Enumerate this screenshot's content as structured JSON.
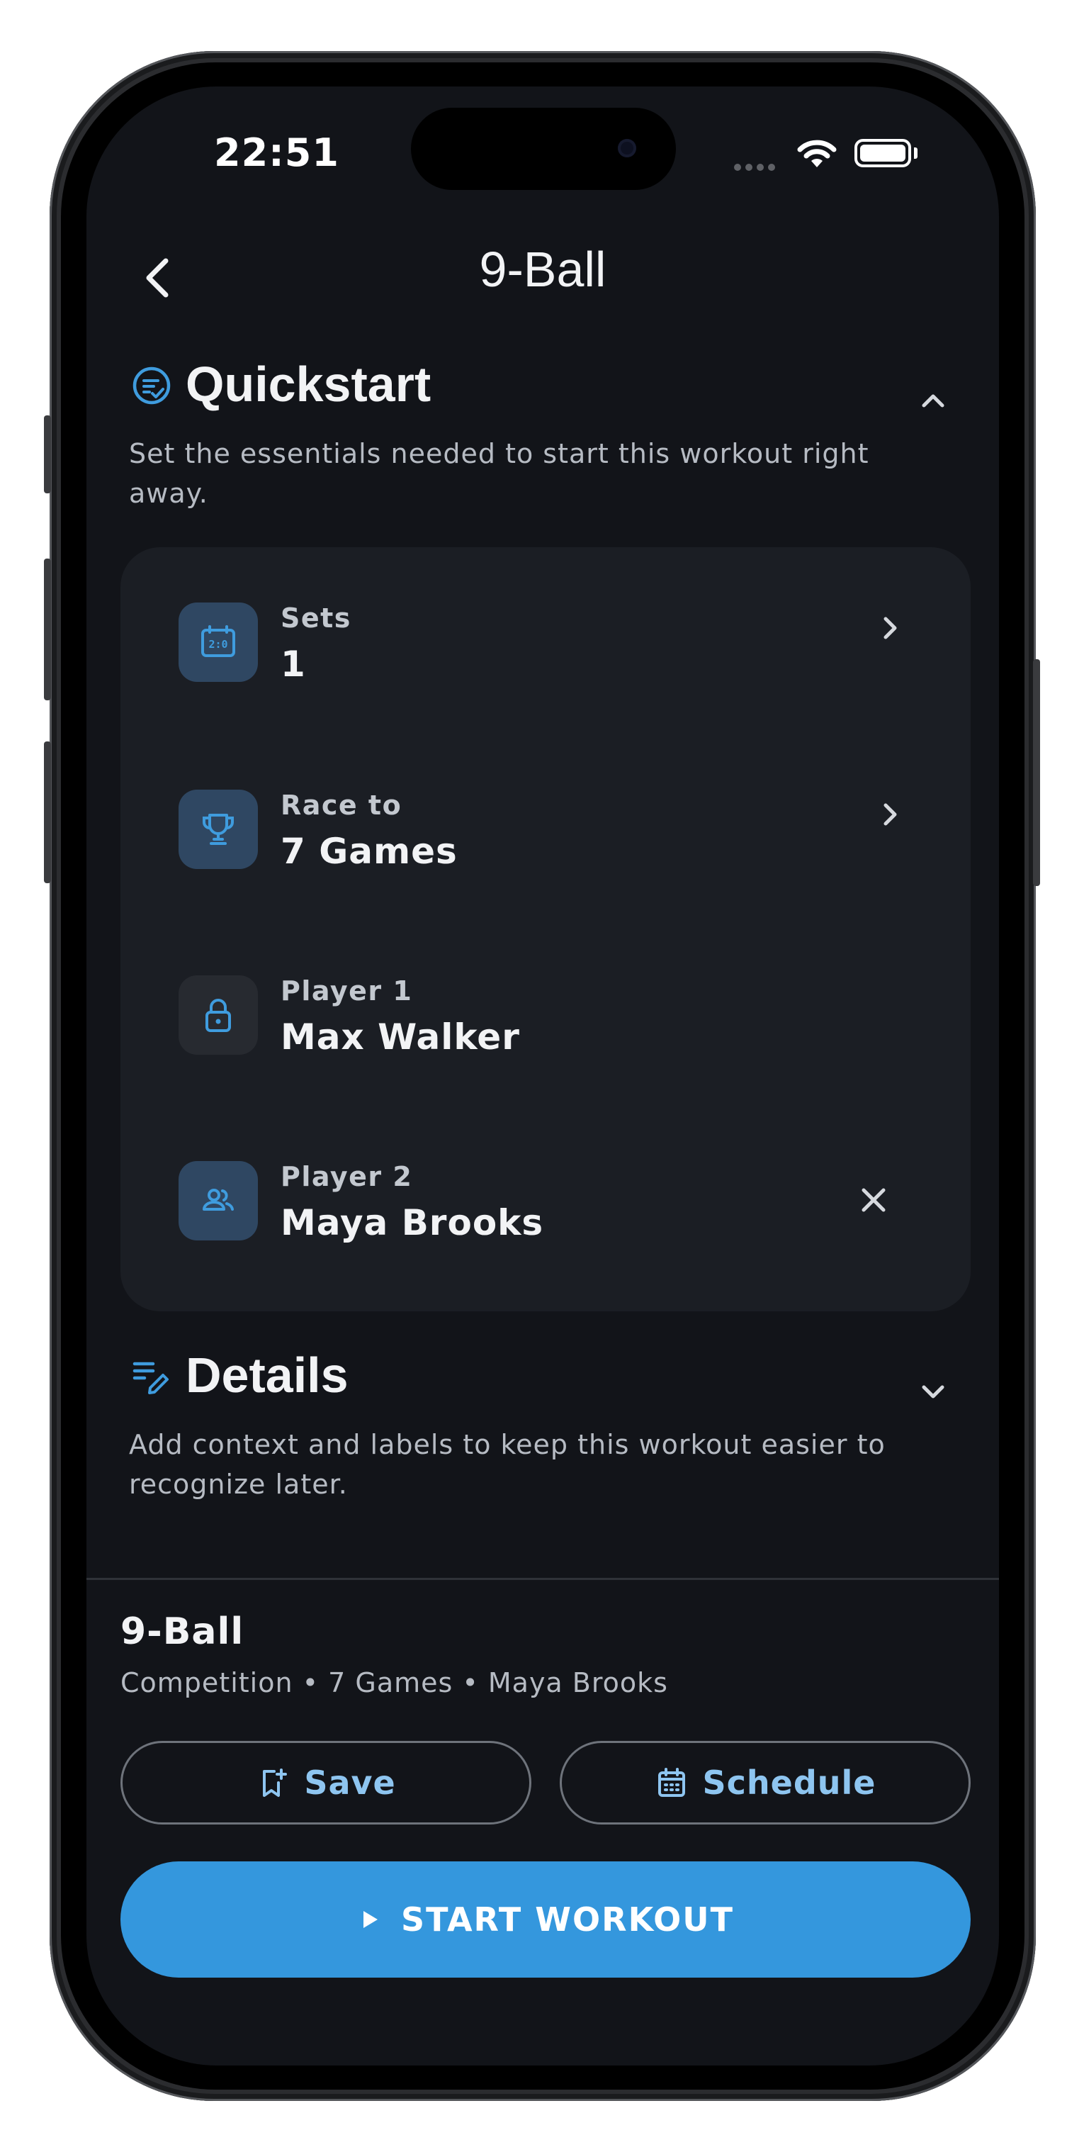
{
  "status_bar": {
    "time": "22:51"
  },
  "header": {
    "title": "9-Ball"
  },
  "quickstart": {
    "title": "Quickstart",
    "description": "Set the essentials needed to start this workout right away.",
    "rows": [
      {
        "label": "Sets",
        "value": "1",
        "icon": "scoreboard-icon",
        "action": "chevron-right-icon"
      },
      {
        "label": "Race to",
        "value": "7 Games",
        "icon": "trophy-icon",
        "action": "chevron-right-icon"
      },
      {
        "label": "Player 1",
        "value": "Max Walker",
        "icon": "lock-icon",
        "action": ""
      },
      {
        "label": "Player 2",
        "value": "Maya Brooks",
        "icon": "group-icon",
        "action": "close-icon"
      }
    ]
  },
  "details": {
    "title": "Details",
    "description": "Add context and labels to keep this workout easier to recognize later."
  },
  "summary": {
    "title": "9-Ball",
    "subtitle": "Competition • 7 Games • Maya Brooks"
  },
  "actions": {
    "save_label": "Save",
    "schedule_label": "Schedule",
    "start_label": "START WORKOUT"
  },
  "colors": {
    "background": "#121419",
    "card": "#1b1e24",
    "accent": "#3497dd",
    "icon_tile": "#2f4762",
    "outline_text": "#8ec5f0"
  }
}
